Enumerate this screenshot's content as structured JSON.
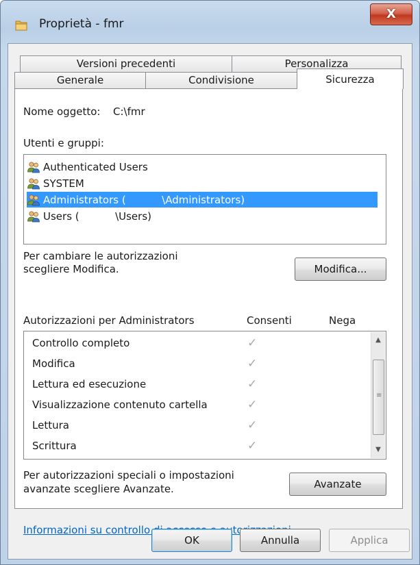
{
  "window": {
    "title": "Proprietà - fmr",
    "close_label": "X",
    "close_icon": "close-icon",
    "folder_icon": "folder-icon"
  },
  "tabs": {
    "row1": [
      "Versioni precedenti",
      "Personalizza"
    ],
    "row2": [
      "Generale",
      "Condivisione",
      "Sicurezza"
    ],
    "selected": "Sicurezza"
  },
  "security": {
    "object_name_label": "Nome oggetto:",
    "object_name_value": "C:\\fmr",
    "groups_label": "Utenti e gruppi:",
    "users": [
      {
        "label": "Authenticated Users",
        "icon": "users-group-icon",
        "selected": false
      },
      {
        "label": "SYSTEM",
        "icon": "users-group-icon",
        "selected": false
      },
      {
        "label": "Administrators (           \\Administrators)",
        "icon": "users-group-icon",
        "selected": true
      },
      {
        "label": "Users (           \\Users)",
        "icon": "users-group-icon",
        "selected": false
      }
    ],
    "change_hint_line1": "Per cambiare le autorizzazioni",
    "change_hint_line2": "scegliere Modifica.",
    "edit_button": "Modifica...",
    "permissions_for_label": "Autorizzazioni per Administrators",
    "allow_header": "Consenti",
    "deny_header": "Nega",
    "permissions": [
      {
        "name": "Controllo completo",
        "allow": "✓",
        "deny": ""
      },
      {
        "name": "Modifica",
        "allow": "✓",
        "deny": ""
      },
      {
        "name": "Lettura ed esecuzione",
        "allow": "✓",
        "deny": ""
      },
      {
        "name": "Visualizzazione contenuto cartella",
        "allow": "✓",
        "deny": ""
      },
      {
        "name": "Lettura",
        "allow": "✓",
        "deny": ""
      },
      {
        "name": "Scrittura",
        "allow": "✓",
        "deny": ""
      }
    ],
    "special_hint_line1": "Per autorizzazioni speciali o impostazioni",
    "special_hint_line2": "avanzate scegliere Avanzate.",
    "advanced_button": "Avanzate",
    "info_link": "Informazioni su controllo di accesso e autorizzazioni"
  },
  "footer": {
    "ok": "OK",
    "cancel": "Annulla",
    "apply": "Applica"
  },
  "colors": {
    "selection": "#3399ff",
    "link": "#0066cc",
    "close_button": "#c0391f"
  }
}
